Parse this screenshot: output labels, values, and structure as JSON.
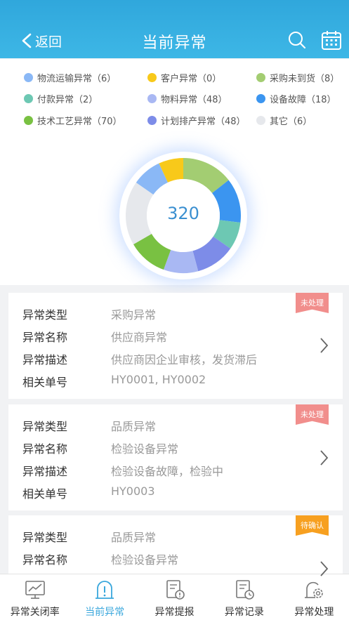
{
  "header": {
    "back_label": "返回",
    "title": "当前异常",
    "search_icon": "search-icon",
    "calendar_icon": "calendar-icon"
  },
  "legend": [
    {
      "label": "物流运输异常（6）",
      "color": "#8ab8f6"
    },
    {
      "label": "客户异常（0）",
      "color": "#f8c91a"
    },
    {
      "label": "采购未到货（8）",
      "color": "#a3cd72"
    },
    {
      "label": "付款异常（2）",
      "color": "#6dc8b3"
    },
    {
      "label": "物料异常（48）",
      "color": "#a9b8f3"
    },
    {
      "label": "设备故障（18）",
      "color": "#3b95f0"
    },
    {
      "label": "技术工艺异常（70）",
      "color": "#79c142"
    },
    {
      "label": "计划排产异常（48）",
      "color": "#7d8ce8"
    },
    {
      "label": "其它（6）",
      "color": "#e6e8ec"
    }
  ],
  "total": "320",
  "cards": [
    {
      "status": "未处理",
      "rows": [
        {
          "k": "异常类型",
          "v": "采购异常"
        },
        {
          "k": "异常名称",
          "v": "供应商异常"
        },
        {
          "k": "异常描述",
          "v": "供应商因企业审核，发货滞后"
        },
        {
          "k": "相关单号",
          "v": "HY0001, HY0002"
        }
      ]
    },
    {
      "status": "未处理",
      "rows": [
        {
          "k": "异常类型",
          "v": "品质异常"
        },
        {
          "k": "异常名称",
          "v": "检验设备异常"
        },
        {
          "k": "异常描述",
          "v": "检验设备故障，检验中"
        },
        {
          "k": "相关单号",
          "v": "HY0003"
        }
      ]
    },
    {
      "status": "待确认",
      "rows": [
        {
          "k": "异常类型",
          "v": "品质异常"
        },
        {
          "k": "异常名称",
          "v": "检验设备异常"
        }
      ]
    }
  ],
  "nav": [
    {
      "label": "异常关闭率",
      "icon": "monitor-chart-icon"
    },
    {
      "label": "当前异常",
      "icon": "alert-bell-icon"
    },
    {
      "label": "异常提报",
      "icon": "report-alert-icon"
    },
    {
      "label": "异常记录",
      "icon": "record-clock-icon"
    },
    {
      "label": "异常处理",
      "icon": "gear-process-icon"
    }
  ],
  "colors": {
    "header": "#3db7e6",
    "active_nav": "#3aa7dc",
    "tag_red": "#f18e8c",
    "tag_orange": "#f7a020"
  }
}
